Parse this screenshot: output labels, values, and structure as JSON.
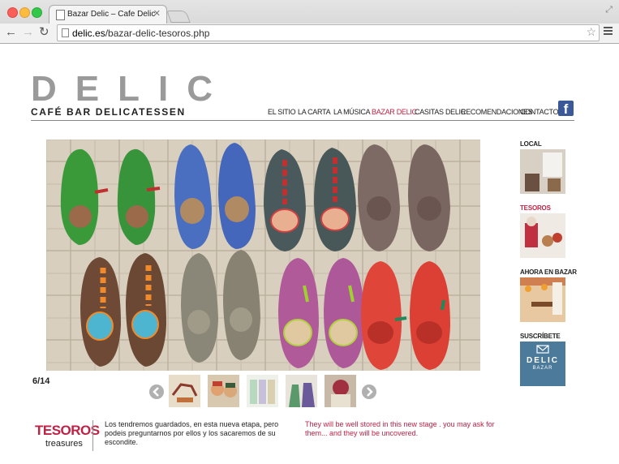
{
  "browser": {
    "tab_title": "Bazar Delic – Cafe Delic",
    "url_host": "delic.es",
    "url_path": "/bazar-delic-tesoros.php"
  },
  "logo": {
    "main": "DELIC",
    "sub": "CAFÉ BAR DELICATESSEN"
  },
  "nav": {
    "items": [
      "EL SITIO",
      "LA CARTA",
      "LA MÚSICA",
      "BAZAR DELIC",
      "CASITAS DELIC",
      "RECOMENDACIONES",
      "CONTACTO"
    ],
    "active": "BAZAR DELIC"
  },
  "social": {
    "facebook_letter": "f"
  },
  "gallery": {
    "counter": "6/14"
  },
  "sidebar": {
    "items": [
      {
        "label": "LOCAL"
      },
      {
        "label": "TESOROS"
      },
      {
        "label": "AHORA EN BAZAR"
      },
      {
        "label": "SUSCRÍBETE"
      }
    ],
    "subscribe_card": {
      "title": "DELIC",
      "subtitle": "BAZAR"
    }
  },
  "footer": {
    "title": "TESOROS",
    "subtitle": "treasures",
    "text_es": "Los tendremos guardados, en esta nueva etapa, pero podeis preguntarnos por ellos y los sacaremos de su escondite.",
    "text_en": "They will be well stored in this new stage . you may ask for them... and they will be uncovered."
  },
  "colors": {
    "accent": "#c02245",
    "facebook": "#3b5998",
    "subscribe_bg": "#4c7a9b"
  }
}
